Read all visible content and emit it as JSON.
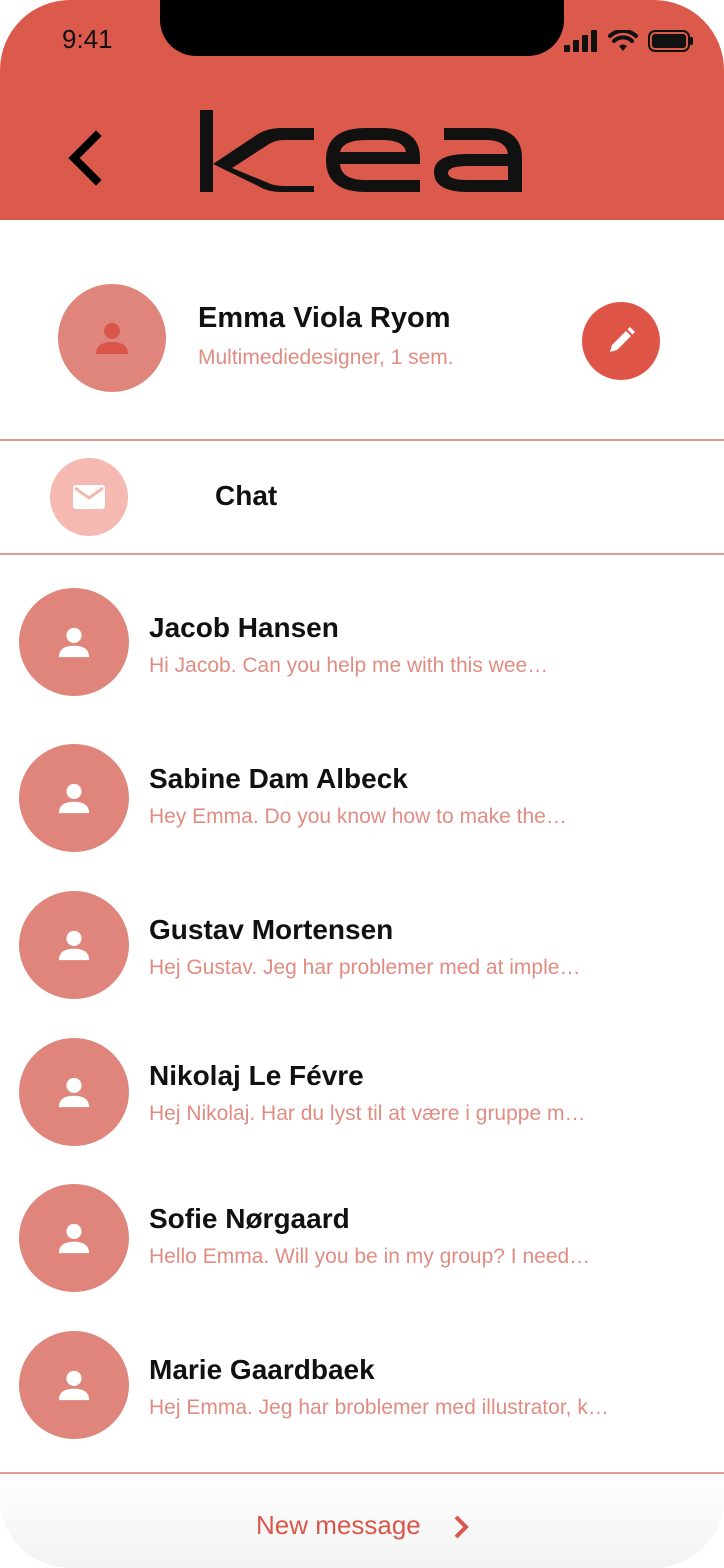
{
  "status_bar": {
    "time": "9:41"
  },
  "header": {
    "logo_text": "KEA",
    "accent": "#dc5a4c"
  },
  "profile": {
    "name": "Emma Viola Ryom",
    "subtitle": "Multimediedesigner, 1 sem."
  },
  "chat_section": {
    "label": "Chat",
    "icon": "mail-icon"
  },
  "conversations": [
    {
      "name": "Jacob Hansen",
      "preview": "Hi Jacob. Can you help me with this wee…"
    },
    {
      "name": "Sabine Dam Albeck",
      "preview": "Hey Emma. Do you know how to make the…"
    },
    {
      "name": "Gustav Mortensen",
      "preview": "Hej Gustav. Jeg har problemer med at imple…"
    },
    {
      "name": "Nikolaj Le Févre",
      "preview": "Hej Nikolaj. Har du lyst til at være i gruppe m…"
    },
    {
      "name": "Sofie Nørgaard",
      "preview": "Hello Emma. Will you be in my group? I need…"
    },
    {
      "name": "Marie Gaardbaek",
      "preview": "Hej Emma. Jeg har broblemer med illustrator, k…"
    }
  ],
  "footer": {
    "new_message_label": "New message"
  }
}
